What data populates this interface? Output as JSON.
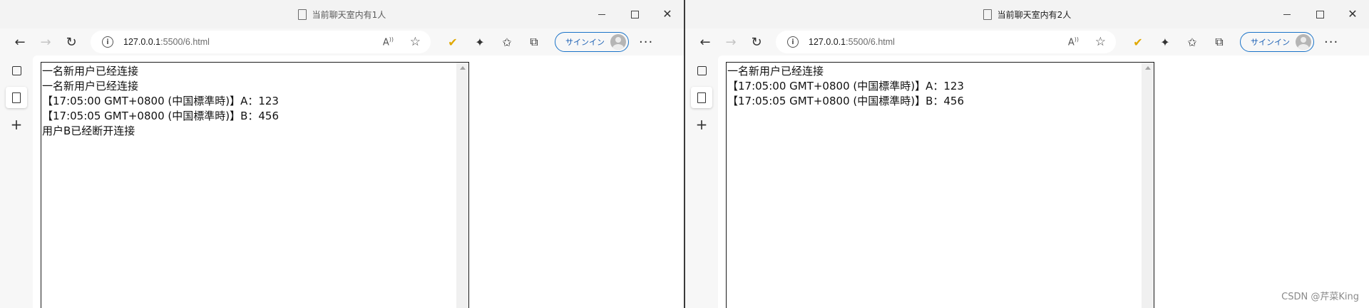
{
  "windows": [
    {
      "title": "当前聊天室内有1人",
      "address": {
        "host": "127.0.0.1",
        "path": ":5500/6.html"
      },
      "signin_label": "サインイン",
      "messages": [
        "一名新用户已经连接",
        "一名新用户已经连接",
        "【17:05:00 GMT+0800 (中国標準時)】A：123",
        "【17:05:05 GMT+0800 (中国標準時)】B：456",
        "用户B已经断开连接"
      ]
    },
    {
      "title": "当前聊天室内有2人",
      "address": {
        "host": "127.0.0.1",
        "path": ":5500/6.html"
      },
      "signin_label": "サインイン",
      "messages": [
        "一名新用户已经连接",
        "【17:05:00 GMT+0800 (中国標準時)】A：123",
        "【17:05:05 GMT+0800 (中国標準時)】B：456"
      ]
    }
  ],
  "icons": {
    "back": "arrow-left-icon",
    "forward": "arrow-right-icon",
    "refresh": "refresh-icon",
    "info": "info-icon",
    "read_aloud": "read-aloud-icon",
    "favorite": "star-plus-icon",
    "extension_1": "checkmark-extension-icon",
    "extension_2": "puzzle-icon",
    "favorites": "favorites-icon",
    "collections": "collections-icon",
    "more": "more-icon"
  },
  "colors": {
    "signin_accent": "#1a73c8",
    "window_chrome": "#f7f7f7"
  },
  "watermark": "CSDN @芹菜King"
}
